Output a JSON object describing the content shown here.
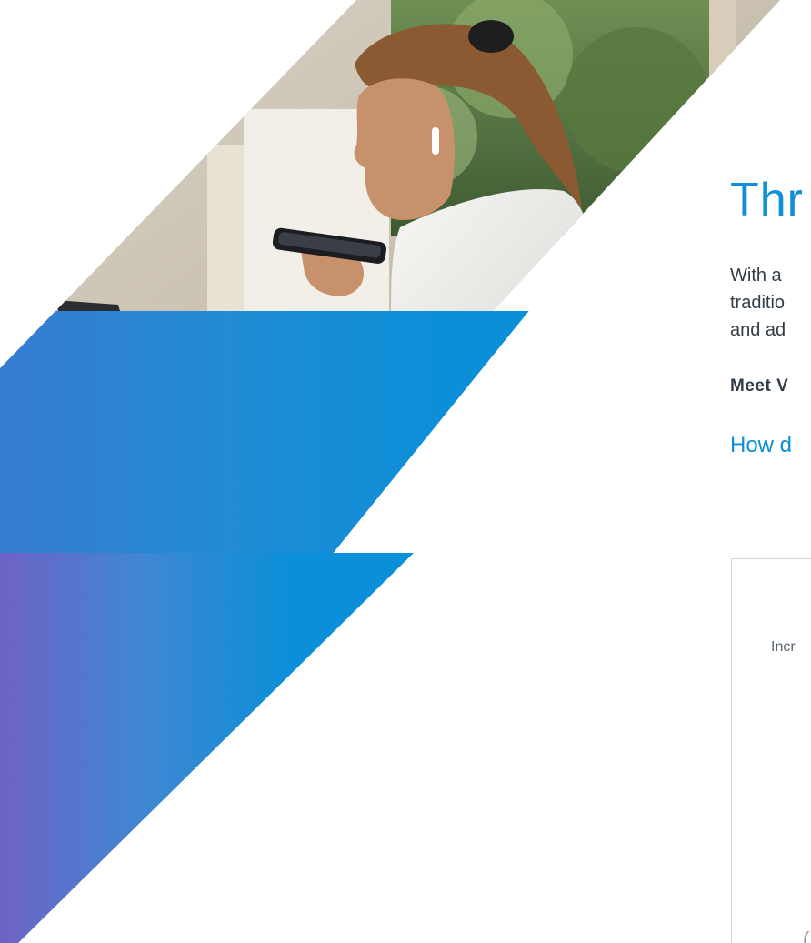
{
  "hero": {
    "image_description_icon": "woman-with-phone-and-laptop-photo",
    "colors": {
      "blue": "#0b8fd8",
      "purple": "#6e63c6"
    }
  },
  "main": {
    "headline": "Thr",
    "body_lines": [
      "With a",
      "traditio",
      "and ad"
    ],
    "meet_text": "Meet V",
    "how_link": "How d"
  },
  "card": {
    "axis_label": "Incr",
    "bottom_char": "("
  }
}
